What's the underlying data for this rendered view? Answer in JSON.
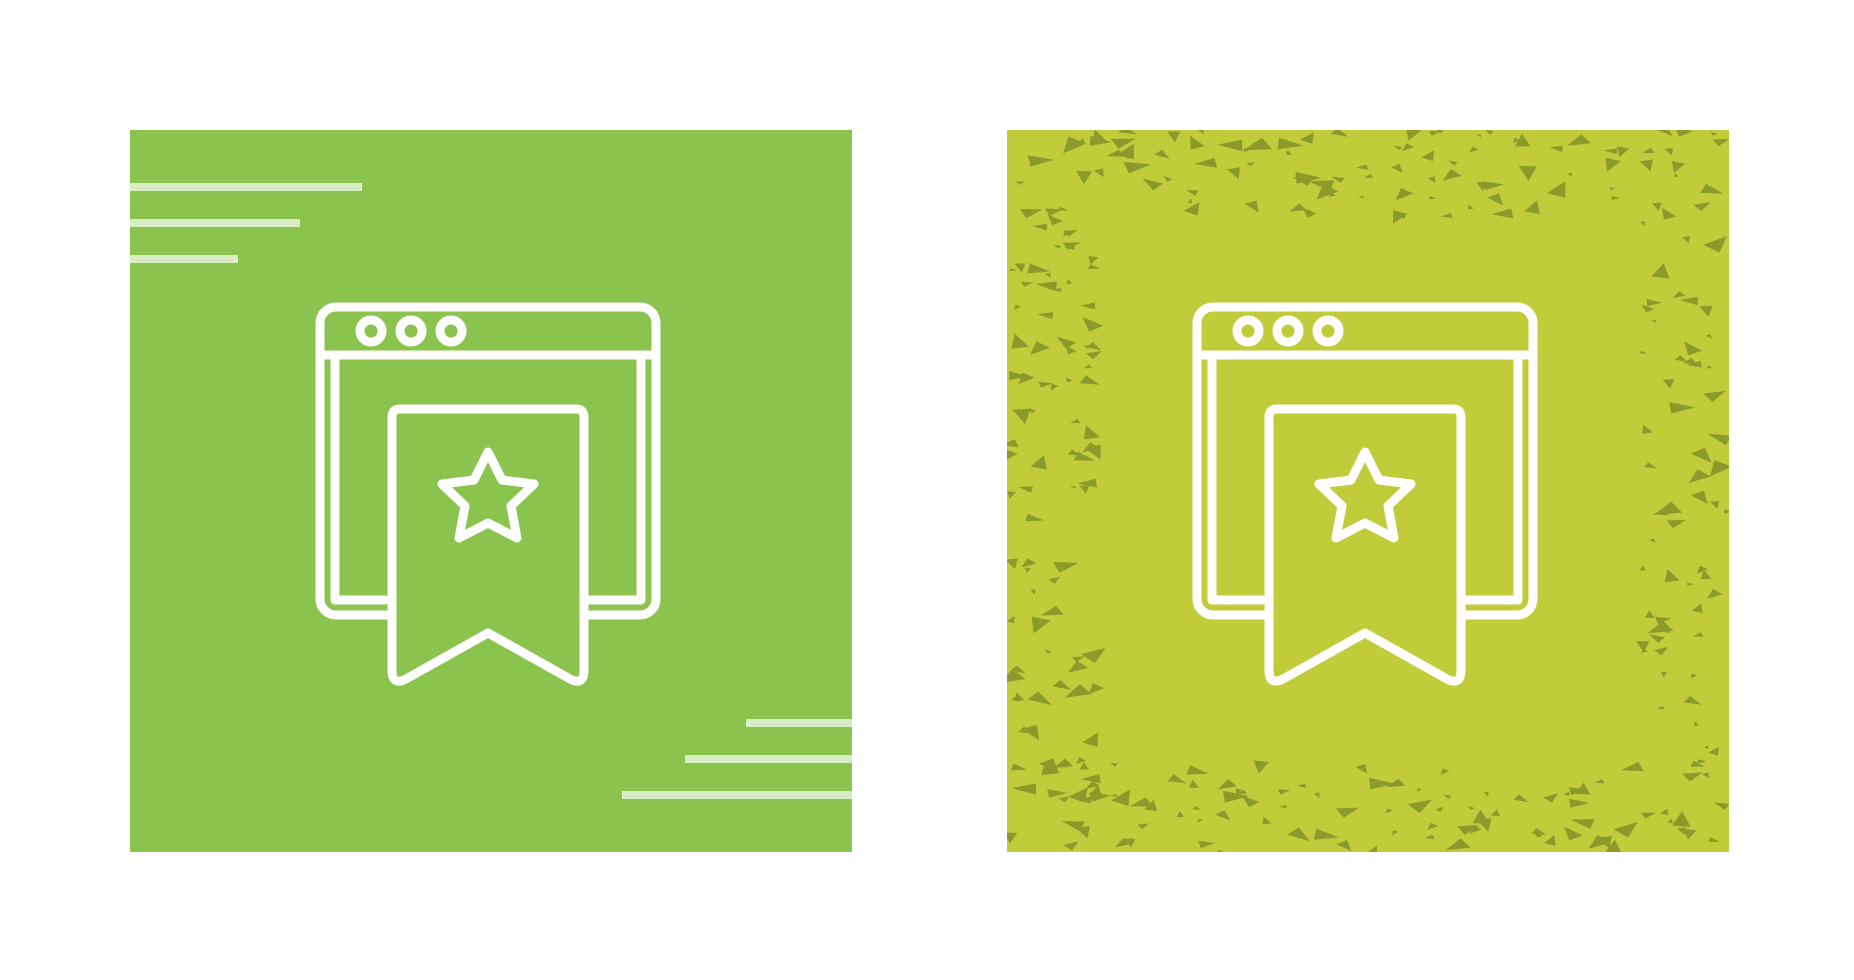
{
  "icons": [
    {
      "name": "browser-bookmark-icon",
      "style": "flat-lines",
      "background_color": "#8bc34f",
      "stroke_color": "#ffffff",
      "accent_line_color": "#d9ecc4"
    },
    {
      "name": "browser-bookmark-icon",
      "style": "grunge-texture",
      "background_color": "#c0cc3a",
      "stroke_color": "#ffffff",
      "texture_color": "#8c9a2c"
    }
  ]
}
